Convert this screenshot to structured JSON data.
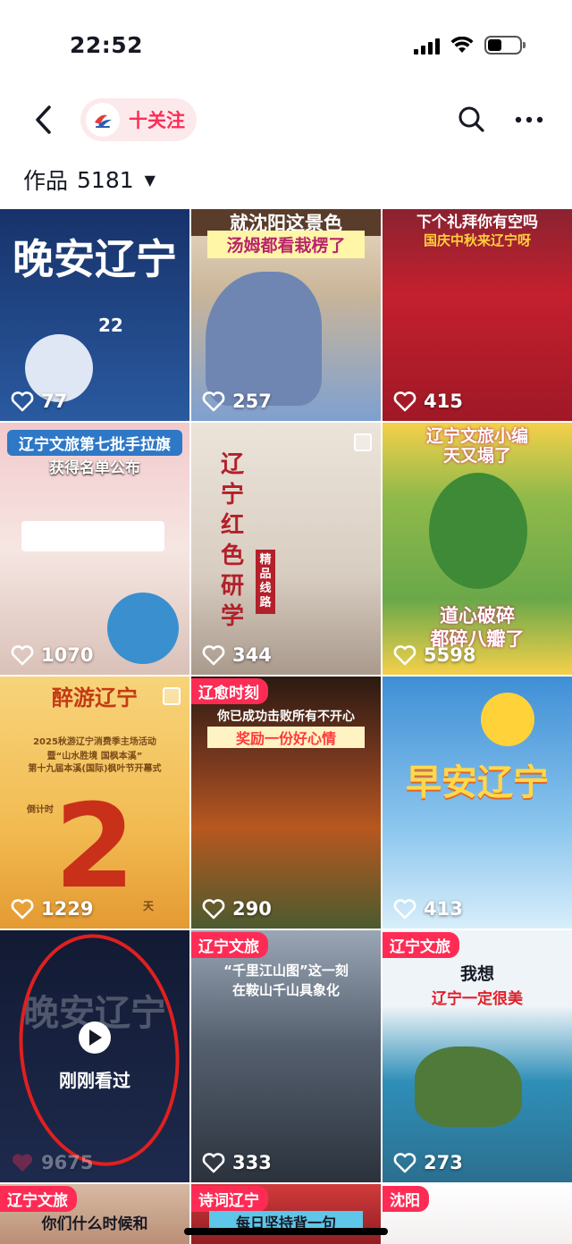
{
  "status_bar": {
    "time": "22:52"
  },
  "nav": {
    "follow_label": "十关注"
  },
  "works": {
    "label": "作品",
    "count": "5181",
    "caret": "▼"
  },
  "tiles": [
    {
      "likes": "77",
      "lines": [
        "晚安辽宁",
        "22"
      ],
      "bg": "#1d3d73"
    },
    {
      "likes": "257",
      "lines": [
        "就沈阳这景色",
        "汤姆都看栽楞了"
      ],
      "bg": "#6a8fc7"
    },
    {
      "likes": "415",
      "lines": [
        "下个礼拜你有空吗",
        "国庆中秋来辽宁呀"
      ],
      "bg": "#b3202c"
    },
    {
      "likes": "1070",
      "lines": [
        "辽宁文旅第七批手拉旗",
        "获得名单公布"
      ],
      "bg": "#e9c9c5"
    },
    {
      "likes": "344",
      "lines": [
        "辽宁红色研学",
        "精品线路"
      ],
      "bg": "#d9d0c7"
    },
    {
      "likes": "5598",
      "lines": [
        "辽宁文旅小编",
        "天又塌了",
        "道心破碎",
        "都碎八瓣了"
      ],
      "bg": "#c4a93a"
    },
    {
      "likes": "1229",
      "lines": [
        "醉游辽宁",
        "2025秋游辽宁消费季主场活动",
        "暨“山水胜境 国枫本溪”",
        "第十九届本溪(国际)枫叶节开幕式",
        "倒计时",
        "2",
        "天"
      ],
      "bg": "#f3c468"
    },
    {
      "likes": "290",
      "tag": "辽愈时刻",
      "lines": [
        "你已成功击败所有不开心",
        "奖励一份好心情"
      ],
      "bg": "#6b3b22"
    },
    {
      "likes": "413",
      "lines": [
        "早安辽宁"
      ],
      "bg": "#5aa9e0"
    },
    {
      "likes": "9675",
      "lines": [
        "晚安辽宁"
      ],
      "seen_label": "刚刚看过",
      "bg": "#1c2644"
    },
    {
      "likes": "333",
      "tag": "辽宁文旅",
      "lines": [
        "“千里江山图”这一刻",
        "在鞍山千山具象化"
      ],
      "bg": "#5a6676"
    },
    {
      "likes": "273",
      "tag": "辽宁文旅",
      "lines": [
        "我想",
        "辽宁一定很美"
      ],
      "bg": "#3b8fb5"
    },
    {
      "tag": "辽宁文旅",
      "lines": [
        "你们什么时候和"
      ],
      "bg": "#c8a08a"
    },
    {
      "tag": "诗词辽宁",
      "lines": [
        "每日坚持背一句"
      ],
      "bg": "#b02a30"
    },
    {
      "tag": "沈阳",
      "lines": [],
      "bg": "#f2eeee"
    }
  ],
  "colors": {
    "accent": "#fe2c55",
    "text": "#161823"
  },
  "icons": [
    "back-icon",
    "logo-icon",
    "search-icon",
    "more-icon",
    "heart-icon",
    "play-icon",
    "multi-image-icon"
  ]
}
